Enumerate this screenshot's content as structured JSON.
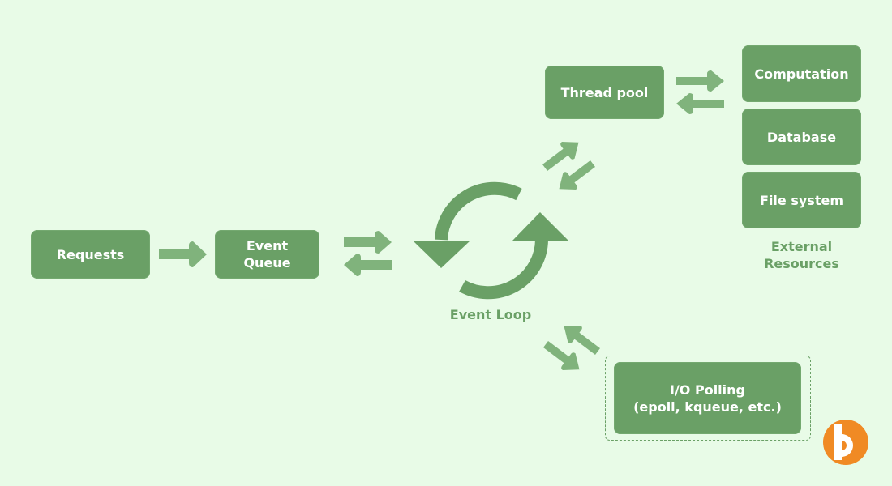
{
  "nodes": {
    "requests": "Requests",
    "event_queue_line1": "Event",
    "event_queue_line2": "Queue",
    "thread_pool": "Thread pool",
    "computation": "Computation",
    "database": "Database",
    "file_system": "File system",
    "io_polling_line1": "I/O Polling",
    "io_polling_line2": "(epoll, kqueue, etc.)"
  },
  "labels": {
    "event_loop": "Event Loop",
    "external_line1": "External",
    "external_line2": "Resources"
  },
  "icons": {
    "event_loop": "cycle-arrows-icon",
    "logo": "brand-logo-icon"
  },
  "colors": {
    "background": "#e8fbe7",
    "box": "#6aa066",
    "arrow": "#80b37c",
    "logo": "#f08a24"
  }
}
